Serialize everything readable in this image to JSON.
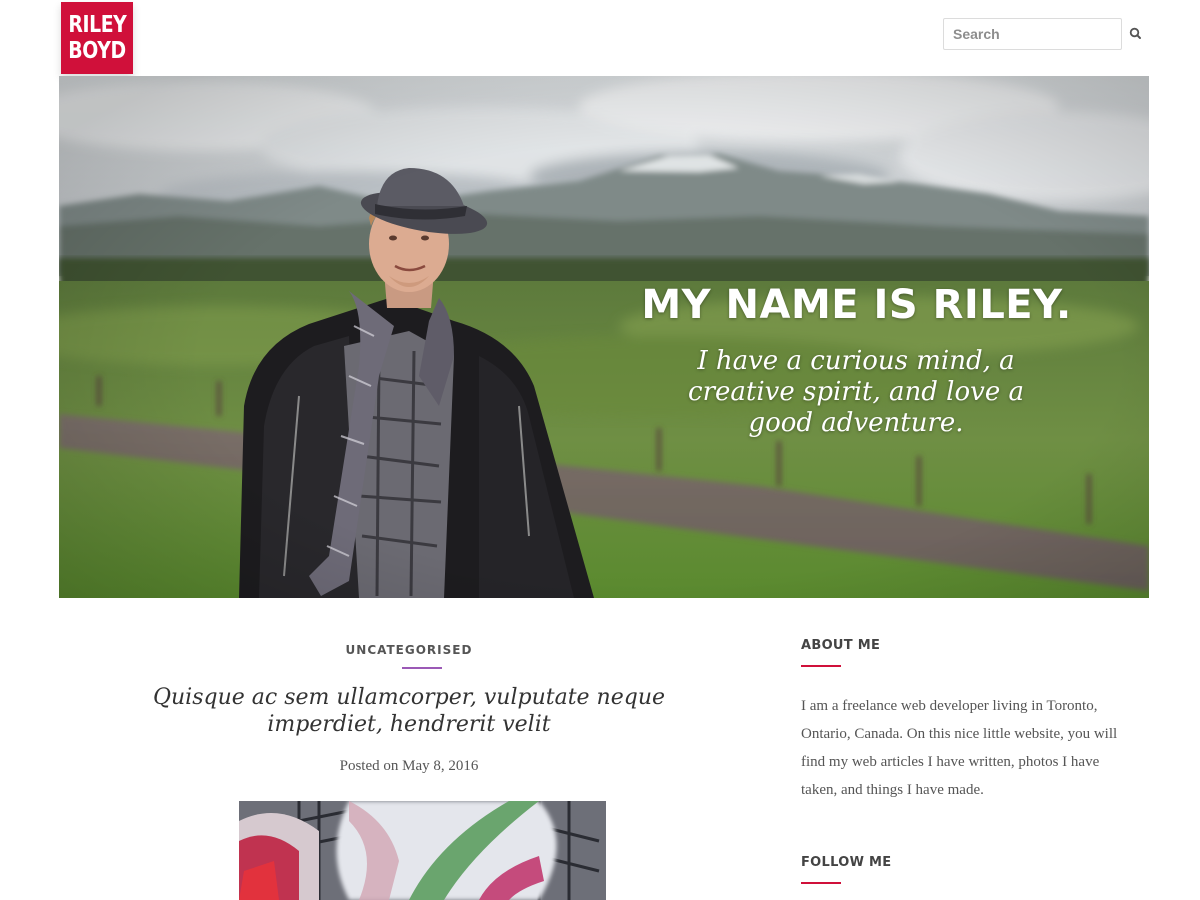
{
  "header": {
    "logo": {
      "line1": "RILEY",
      "line2": "BOYD"
    },
    "search": {
      "placeholder": "Search",
      "icon": "search-icon"
    }
  },
  "hero": {
    "title": "MY NAME IS RILEY.",
    "subtitle": "I have a curious mind, a creative spirit, and love a good adventure."
  },
  "post": {
    "category": "UNCATEGORISED",
    "title": "Quisque ac sem ullamcorper, vulputate neque imperdiet, hendrerit velit",
    "meta_prefix": "Posted on",
    "date": "May 8, 2016"
  },
  "sidebar": {
    "about": {
      "title": "ABOUT ME",
      "text": "I am a freelance web developer living in Toronto, Ontario, Canada. On this nice little website, you will find my web articles I have written, photos I have taken, and things I have made."
    },
    "follow": {
      "title": "FOLLOW ME"
    }
  },
  "colors": {
    "brand": "#d0103a",
    "category_rule": "#9b59b6",
    "text": "#333333"
  }
}
